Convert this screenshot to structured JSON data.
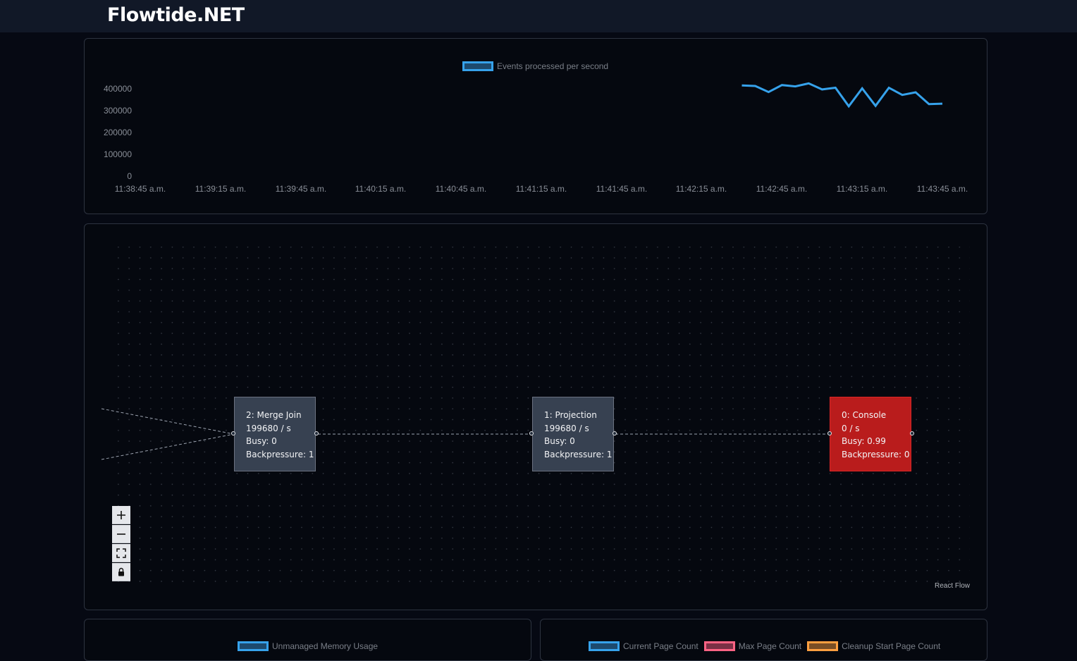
{
  "header": {
    "title": "Flowtide.NET"
  },
  "events_chart": {
    "legend": "Events processed per second",
    "y_ticks": [
      "400000",
      "300000",
      "200000",
      "100000",
      "0"
    ],
    "x_ticks": [
      "11:38:45 a.m.",
      "11:39:15 a.m.",
      "11:39:45 a.m.",
      "11:40:15 a.m.",
      "11:40:45 a.m.",
      "11:41:15 a.m.",
      "11:41:45 a.m.",
      "11:42:15 a.m.",
      "11:42:45 a.m.",
      "11:43:15 a.m.",
      "11:43:45 a.m."
    ],
    "line_color": "#36a2eb"
  },
  "chart_data": {
    "type": "line",
    "legend_placement": "top",
    "grid": false,
    "ylim": [
      0,
      400000
    ],
    "x": [
      "11:42:30 a.m.",
      "11:42:35 a.m.",
      "11:42:40 a.m.",
      "11:42:45 a.m.",
      "11:42:50 a.m.",
      "11:42:55 a.m.",
      "11:43:00 a.m.",
      "11:43:05 a.m.",
      "11:43:10 a.m.",
      "11:43:15 a.m.",
      "11:43:20 a.m.",
      "11:43:25 a.m.",
      "11:43:30 a.m.",
      "11:43:35 a.m.",
      "11:43:40 a.m.",
      "11:43:45 a.m."
    ],
    "series": [
      {
        "name": "Events processed per second",
        "values": [
          415000,
          413000,
          385000,
          417000,
          411000,
          425000,
          397000,
          405000,
          320000,
          402000,
          322000,
          405000,
          372000,
          384000,
          330000,
          332000
        ]
      }
    ]
  },
  "graph": {
    "nodes": [
      {
        "title": "2: Merge Join",
        "rate": "199680 / s",
        "busy": "Busy: 0",
        "backpressure": "Backpressure: 1"
      },
      {
        "title": "1: Projection",
        "rate": "199680 / s",
        "busy": "Busy: 0",
        "backpressure": "Backpressure: 1"
      },
      {
        "title": "0: Console",
        "rate": "0 / s",
        "busy": "Busy: 0.99",
        "backpressure": "Backpressure: 0"
      }
    ],
    "controls": {
      "zoom_in": "zoom-in",
      "zoom_out": "zoom-out",
      "fit": "fit-view",
      "lock": "lock"
    },
    "attribution": "React Flow",
    "alert_color": "#b91c1c"
  },
  "memory_chart": {
    "legend": "Unmanaged Memory Usage"
  },
  "page_chart": {
    "legends": [
      {
        "label": "Current Page Count",
        "color": "#36a2eb"
      },
      {
        "label": "Max Page Count",
        "color": "#ff6384"
      },
      {
        "label": "Cleanup Start Page Count",
        "color": "#ff9f40"
      }
    ]
  }
}
